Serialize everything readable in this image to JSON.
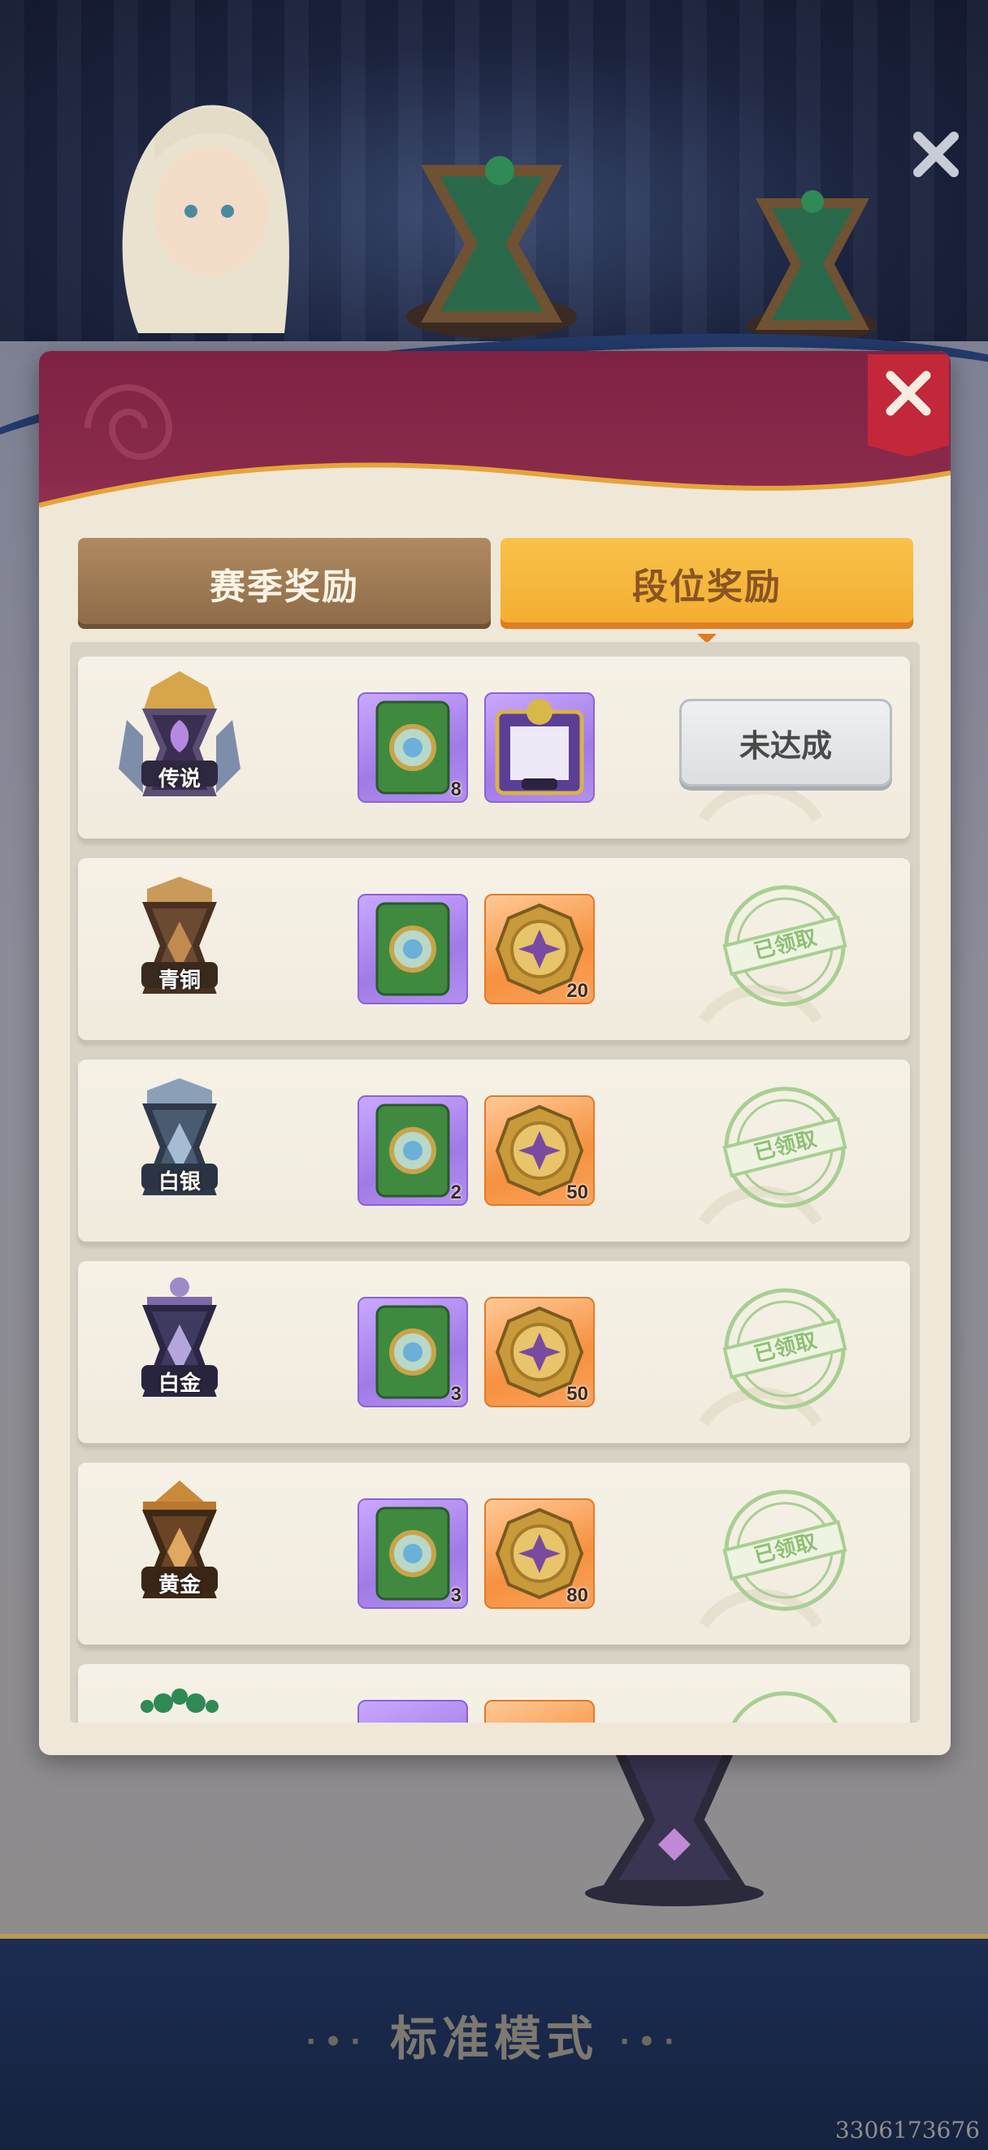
{
  "mode": {
    "title": "标准模式"
  },
  "watermark": "3306173676",
  "tabs": [
    {
      "label": "赛季奖励",
      "active": false
    },
    {
      "label": "段位奖励",
      "active": true
    }
  ],
  "colors": {
    "header": "#7e2243",
    "tab_active": "#f2ad2f",
    "tab_inactive": "#8c6a46",
    "claimed_stamp": "#8fbf74"
  },
  "ranks": [
    {
      "name": "传说",
      "items": [
        {
          "type": "card-pack",
          "count": "8"
        },
        {
          "type": "avatar-frame",
          "count": ""
        }
      ],
      "status": "未达成"
    },
    {
      "name": "青铜",
      "items": [
        {
          "type": "card-pack",
          "count": ""
        },
        {
          "type": "gold-coin",
          "count": "20"
        }
      ],
      "status": "已领取"
    },
    {
      "name": "白银",
      "items": [
        {
          "type": "card-pack",
          "count": "2"
        },
        {
          "type": "gold-coin",
          "count": "50"
        }
      ],
      "status": "已领取"
    },
    {
      "name": "白金",
      "items": [
        {
          "type": "card-pack",
          "count": "3"
        },
        {
          "type": "gold-coin",
          "count": "50"
        }
      ],
      "status": "已领取"
    },
    {
      "name": "黄金",
      "items": [
        {
          "type": "card-pack",
          "count": "3"
        },
        {
          "type": "gold-coin",
          "count": "80"
        }
      ],
      "status": "已领取"
    },
    {
      "name": "",
      "items": [
        {
          "type": "card-pack",
          "count": ""
        },
        {
          "type": "gold-coin",
          "count": ""
        }
      ],
      "status": ""
    }
  ]
}
